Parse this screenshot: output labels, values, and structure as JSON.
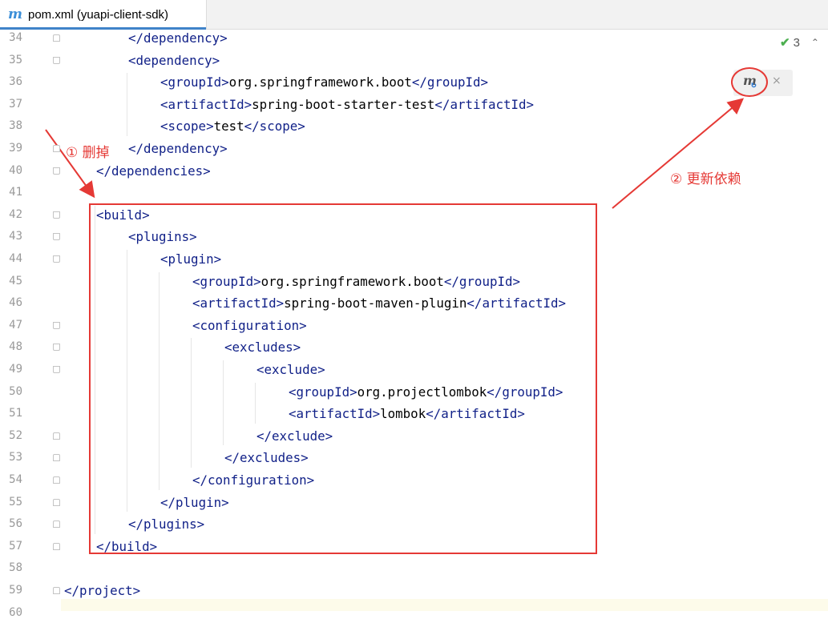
{
  "tab": {
    "icon": "m",
    "label": "pom.xml (yuapi-client-sdk)"
  },
  "inspection": {
    "count": "3"
  },
  "maven_popup": {
    "icon": "m",
    "close": "×"
  },
  "annotations": {
    "delete": "① 删掉",
    "update": "② 更新依赖"
  },
  "lines": [
    {
      "n": "34",
      "indent": 2,
      "parts": [
        [
          "t",
          "</"
        ],
        [
          "t",
          "dependency"
        ],
        [
          "t",
          ">"
        ]
      ]
    },
    {
      "n": "35",
      "indent": 2,
      "parts": [
        [
          "t",
          "<"
        ],
        [
          "t",
          "dependency"
        ],
        [
          "t",
          ">"
        ]
      ]
    },
    {
      "n": "36",
      "indent": 3,
      "parts": [
        [
          "t",
          "<"
        ],
        [
          "t",
          "groupId"
        ],
        [
          "t",
          ">"
        ],
        [
          "x",
          "org.springframework.boot"
        ],
        [
          "t",
          "</"
        ],
        [
          "t",
          "groupId"
        ],
        [
          "t",
          ">"
        ]
      ]
    },
    {
      "n": "37",
      "indent": 3,
      "parts": [
        [
          "t",
          "<"
        ],
        [
          "t",
          "artifactId"
        ],
        [
          "t",
          ">"
        ],
        [
          "x",
          "spring-boot-starter-test"
        ],
        [
          "t",
          "</"
        ],
        [
          "t",
          "artifactId"
        ],
        [
          "t",
          ">"
        ]
      ]
    },
    {
      "n": "38",
      "indent": 3,
      "parts": [
        [
          "t",
          "<"
        ],
        [
          "t",
          "scope"
        ],
        [
          "t",
          ">"
        ],
        [
          "x",
          "test"
        ],
        [
          "t",
          "</"
        ],
        [
          "t",
          "scope"
        ],
        [
          "t",
          ">"
        ]
      ]
    },
    {
      "n": "39",
      "indent": 2,
      "parts": [
        [
          "t",
          "</"
        ],
        [
          "t",
          "dependency"
        ],
        [
          "t",
          ">"
        ]
      ]
    },
    {
      "n": "40",
      "indent": 1,
      "parts": [
        [
          "t",
          "</"
        ],
        [
          "t",
          "dependencies"
        ],
        [
          "t",
          ">"
        ]
      ]
    },
    {
      "n": "41",
      "indent": 0,
      "parts": []
    },
    {
      "n": "42",
      "indent": 1,
      "parts": [
        [
          "t",
          "<"
        ],
        [
          "t",
          "build"
        ],
        [
          "t",
          ">"
        ]
      ]
    },
    {
      "n": "43",
      "indent": 2,
      "parts": [
        [
          "t",
          "<"
        ],
        [
          "t",
          "plugins"
        ],
        [
          "t",
          ">"
        ]
      ]
    },
    {
      "n": "44",
      "indent": 3,
      "parts": [
        [
          "t",
          "<"
        ],
        [
          "t",
          "plugin"
        ],
        [
          "t",
          ">"
        ]
      ]
    },
    {
      "n": "45",
      "indent": 4,
      "parts": [
        [
          "t",
          "<"
        ],
        [
          "t",
          "groupId"
        ],
        [
          "t",
          ">"
        ],
        [
          "x",
          "org.springframework.boot"
        ],
        [
          "t",
          "</"
        ],
        [
          "t",
          "groupId"
        ],
        [
          "t",
          ">"
        ]
      ]
    },
    {
      "n": "46",
      "indent": 4,
      "parts": [
        [
          "t",
          "<"
        ],
        [
          "t",
          "artifactId"
        ],
        [
          "t",
          ">"
        ],
        [
          "x",
          "spring-boot-maven-plugin"
        ],
        [
          "t",
          "</"
        ],
        [
          "t",
          "artifactId"
        ],
        [
          "t",
          ">"
        ]
      ]
    },
    {
      "n": "47",
      "indent": 4,
      "parts": [
        [
          "t",
          "<"
        ],
        [
          "t",
          "configuration"
        ],
        [
          "t",
          ">"
        ]
      ]
    },
    {
      "n": "48",
      "indent": 5,
      "parts": [
        [
          "t",
          "<"
        ],
        [
          "t",
          "excludes"
        ],
        [
          "t",
          ">"
        ]
      ]
    },
    {
      "n": "49",
      "indent": 6,
      "parts": [
        [
          "t",
          "<"
        ],
        [
          "t",
          "exclude"
        ],
        [
          "t",
          ">"
        ]
      ]
    },
    {
      "n": "50",
      "indent": 7,
      "parts": [
        [
          "t",
          "<"
        ],
        [
          "t",
          "groupId"
        ],
        [
          "t",
          ">"
        ],
        [
          "x",
          "org.projectlombok"
        ],
        [
          "t",
          "</"
        ],
        [
          "t",
          "groupId"
        ],
        [
          "t",
          ">"
        ]
      ]
    },
    {
      "n": "51",
      "indent": 7,
      "parts": [
        [
          "t",
          "<"
        ],
        [
          "t",
          "artifactId"
        ],
        [
          "t",
          ">"
        ],
        [
          "x",
          "lombok"
        ],
        [
          "t",
          "</"
        ],
        [
          "t",
          "artifactId"
        ],
        [
          "t",
          ">"
        ]
      ]
    },
    {
      "n": "52",
      "indent": 6,
      "parts": [
        [
          "t",
          "</"
        ],
        [
          "t",
          "exclude"
        ],
        [
          "t",
          ">"
        ]
      ]
    },
    {
      "n": "53",
      "indent": 5,
      "parts": [
        [
          "t",
          "</"
        ],
        [
          "t",
          "excludes"
        ],
        [
          "t",
          ">"
        ]
      ]
    },
    {
      "n": "54",
      "indent": 4,
      "parts": [
        [
          "t",
          "</"
        ],
        [
          "t",
          "configuration"
        ],
        [
          "t",
          ">"
        ]
      ]
    },
    {
      "n": "55",
      "indent": 3,
      "parts": [
        [
          "t",
          "</"
        ],
        [
          "t",
          "plugin"
        ],
        [
          "t",
          ">"
        ]
      ]
    },
    {
      "n": "56",
      "indent": 2,
      "parts": [
        [
          "t",
          "</"
        ],
        [
          "t",
          "plugins"
        ],
        [
          "t",
          ">"
        ]
      ]
    },
    {
      "n": "57",
      "indent": 1,
      "parts": [
        [
          "t",
          "</"
        ],
        [
          "t",
          "build"
        ],
        [
          "t",
          ">"
        ]
      ]
    },
    {
      "n": "58",
      "indent": 0,
      "parts": []
    },
    {
      "n": "59",
      "indent": 0,
      "parts": [
        [
          "t",
          "</"
        ],
        [
          "t",
          "project"
        ],
        [
          "t",
          ">"
        ]
      ]
    },
    {
      "n": "60",
      "indent": 0,
      "parts": []
    }
  ]
}
